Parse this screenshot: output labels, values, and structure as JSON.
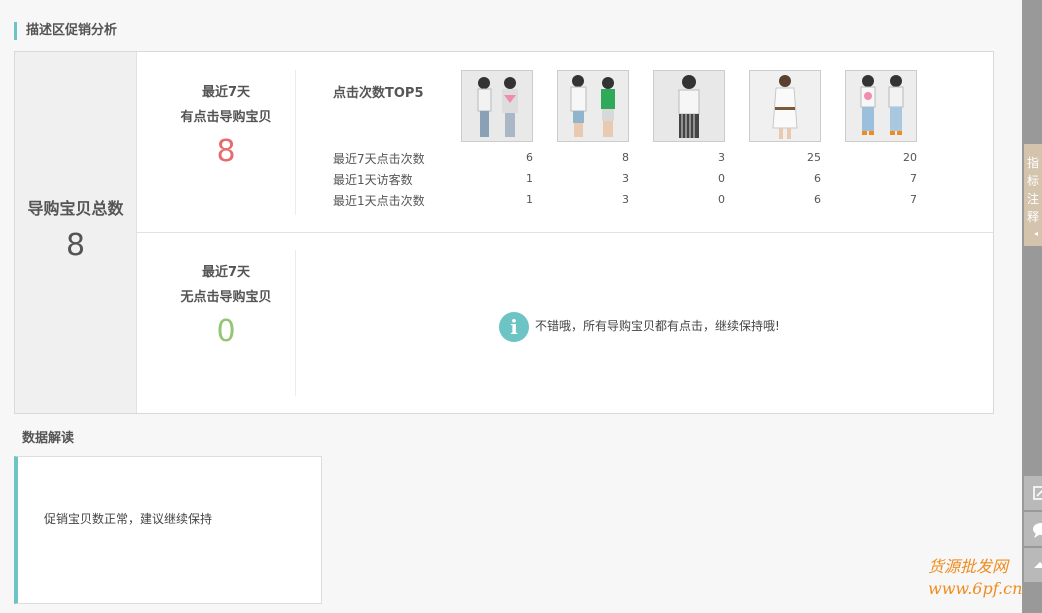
{
  "section": {
    "title": "描述区促销分析"
  },
  "total": {
    "label": "导购宝贝总数",
    "value": "8"
  },
  "clicked": {
    "line1": "最近7天",
    "line2": "有点击导购宝贝",
    "value": "8",
    "color": "#e8696f"
  },
  "unclicked": {
    "line1": "最近7天",
    "line2": "无点击导购宝贝",
    "value": "0",
    "color": "#93c572"
  },
  "top5": {
    "title": "点击次数TOP5",
    "metric_labels": [
      "最近7天点击次数",
      "最近1天访客数",
      "最近1天点击次数"
    ],
    "products": [
      {
        "icon": "product-thumbnail",
        "clicks_7d": "6",
        "visitors_1d": "1",
        "clicks_1d": "1"
      },
      {
        "icon": "product-thumbnail",
        "clicks_7d": "8",
        "visitors_1d": "3",
        "clicks_1d": "3"
      },
      {
        "icon": "product-thumbnail",
        "clicks_7d": "3",
        "visitors_1d": "0",
        "clicks_1d": "0"
      },
      {
        "icon": "product-thumbnail",
        "clicks_7d": "25",
        "visitors_1d": "6",
        "clicks_1d": "6"
      },
      {
        "icon": "product-thumbnail",
        "clicks_7d": "20",
        "visitors_1d": "7",
        "clicks_1d": "7"
      }
    ]
  },
  "info": {
    "icon": "info-icon",
    "glyph": "i",
    "message": "不错哦，所有导购宝贝都有点击，继续保持哦!"
  },
  "interpretation": {
    "title": "数据解读",
    "text": "促销宝贝数正常，建议继续保持"
  },
  "sidebar": {
    "tab_text": "指标注释",
    "arrow": "◂"
  },
  "watermark": {
    "line1": "货源批发网",
    "line2": "www.6pf.cn"
  },
  "colors": {
    "accent": "#6cc4c4",
    "red": "#e8696f",
    "green": "#93c572"
  }
}
